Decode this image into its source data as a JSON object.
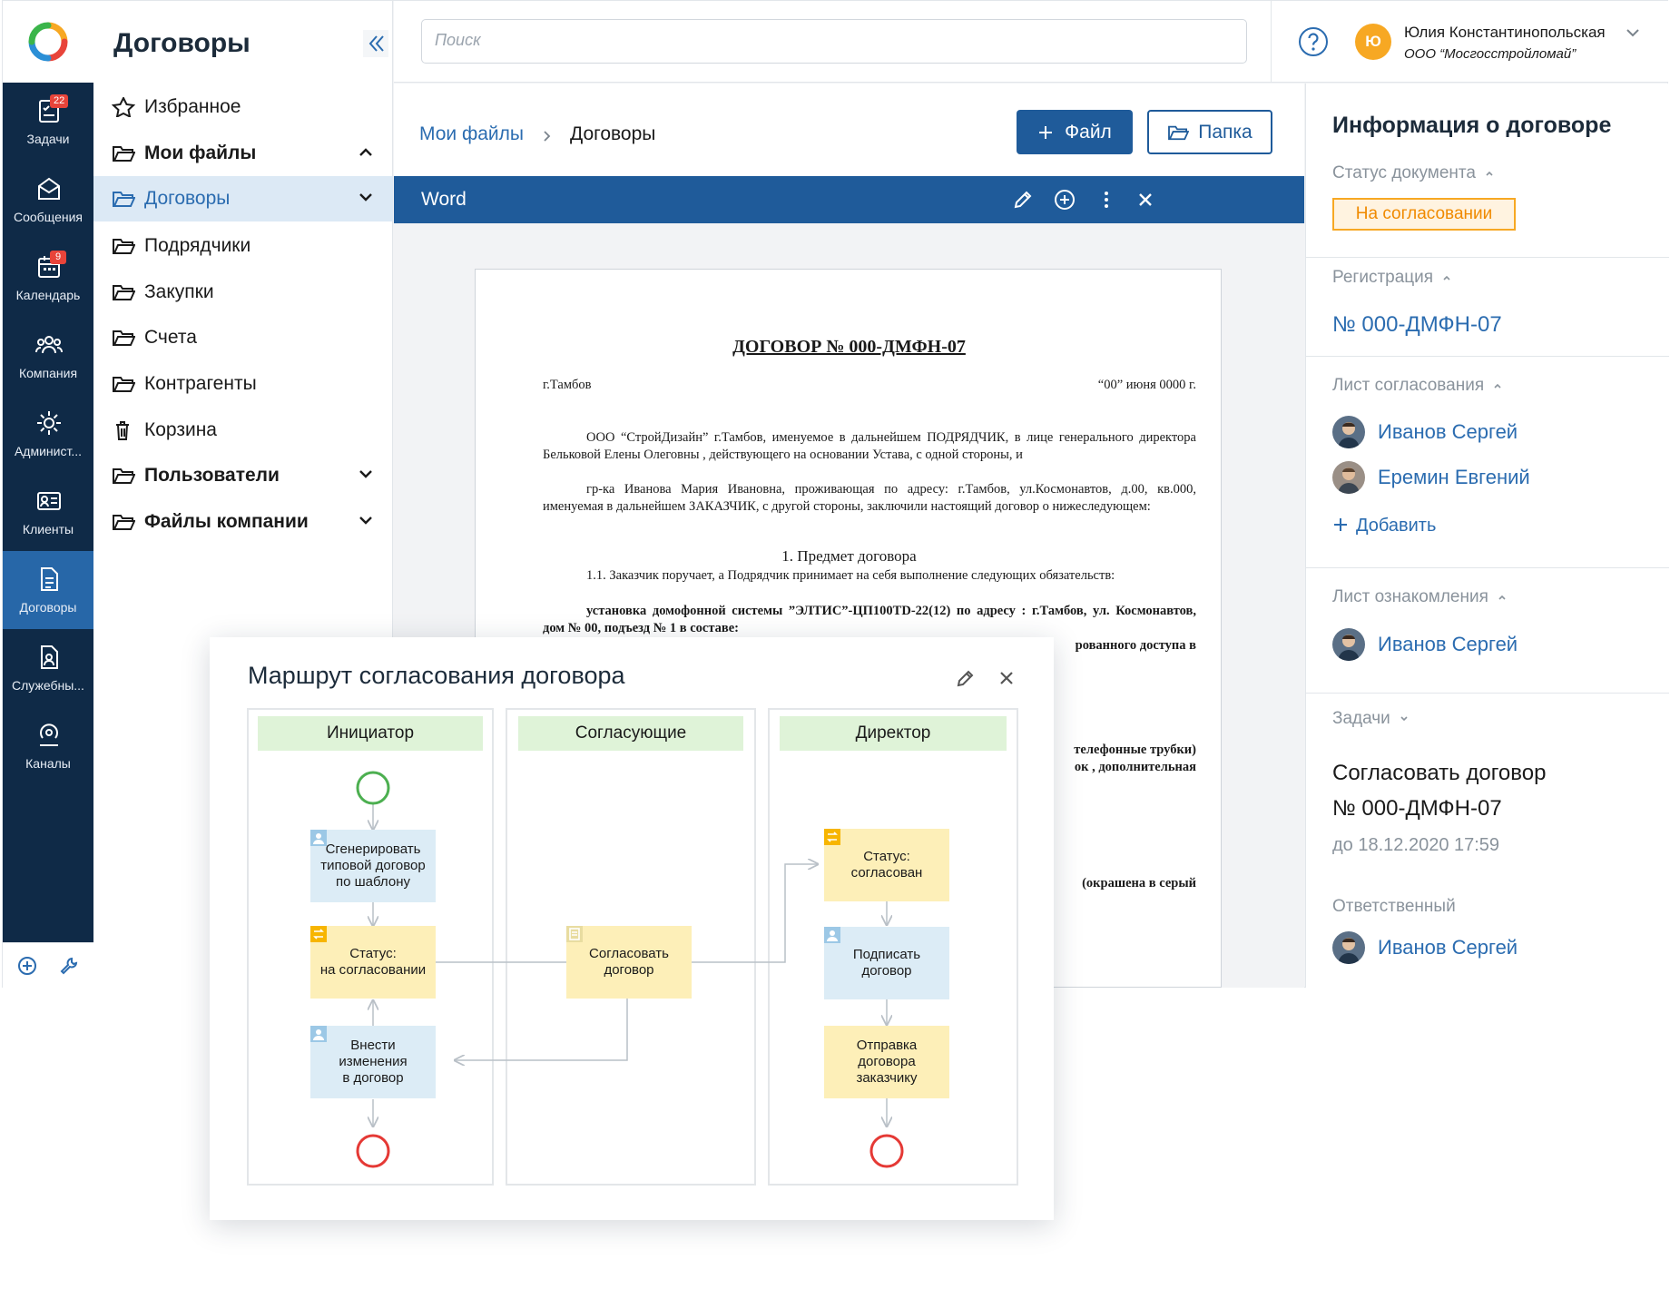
{
  "rail": {
    "items": [
      {
        "label": "Задачи",
        "count": "22"
      },
      {
        "label": "Сообщения"
      },
      {
        "label": "Календарь",
        "count": "9"
      },
      {
        "label": "Компания"
      },
      {
        "label": "Админист..."
      },
      {
        "label": "Клиенты"
      },
      {
        "label": "Договоры"
      },
      {
        "label": "Служебны..."
      },
      {
        "label": "Каналы"
      }
    ]
  },
  "tree": {
    "title": "Договоры",
    "items": [
      {
        "label": "Избранное"
      },
      {
        "label": "Мои файлы"
      },
      {
        "label": "Договоры"
      },
      {
        "label": "Подрядчики"
      },
      {
        "label": "Закупки"
      },
      {
        "label": "Счета"
      },
      {
        "label": "Контрагенты"
      },
      {
        "label": "Корзина"
      },
      {
        "label": "Пользователи"
      },
      {
        "label": "Файлы компании"
      }
    ]
  },
  "topbar": {
    "search_placeholder": "Поиск",
    "avatar_letter": "Ю",
    "user_name": "Юлия Константинопольская",
    "user_org": "ООО “Мосгосстройломай”"
  },
  "main": {
    "breadcrumb": {
      "parent": "Мои файлы",
      "current": "Договоры"
    },
    "file_button": "Файл",
    "folder_button": "Папка",
    "doc_title": "Word"
  },
  "document": {
    "heading": "ДОГОВОР № 000-ДМФН-07",
    "city": "г.Тамбов",
    "date": "“00” июня   0000 г.",
    "para1a": "ООО “СтройДизайн” г.Тамбов, именуемое в дальнейшем ПОДРЯДЧИК, в лице генерального директора Бельковой Елены Олеговны , действующего на основании Устава, с одной стороны, и",
    "para1b": "гр-ка Иванова Мария Ивановна, проживающая по адресу: г.Тамбов, ул.Космонавтов, д.00, кв.000, именуемая в дальнейшем ЗАКАЗЧИК, с другой стороны, заключили настоящий договор о нижеследующем:",
    "section1": "1. Предмет договора",
    "clause11": "1.1. Заказчик поручает, а Подрядчик принимает на себя выполнение следующих обязательств:",
    "clause11b": "установка домофонной системы ”ЭЛТИС”-ЦП100TD-22(12) по адресу : г.Тамбов, ул. Космонавтов, дом № 00, подъезд № 1 в составе:",
    "frag1": "рованного доступа в",
    "frag2": "телефонные трубки)",
    "frag3": "ок , дополнительная",
    "frag4": "(окрашена в серый"
  },
  "info": {
    "title": "Информация о договоре",
    "status_label": "Статус документа",
    "status_value": "На согласовании",
    "reg_label": "Регистрация",
    "reg_number": "№ 000-ДМФН-07",
    "approval_label": "Лист согласования",
    "approvers": [
      "Иванов Сергей",
      "Еремин Евгений"
    ],
    "add_label": "Добавить",
    "ack_label": "Лист ознакомления",
    "ack_people": [
      "Иванов Сергей"
    ],
    "tasks_label": "Задачи",
    "task_line1": "Согласовать договор",
    "task_line2": "№ 000-ДМФН-07",
    "task_due": "до 18.12.2020  17:59",
    "responsible_label": "Ответственный",
    "responsible": "Иванов Сергей"
  },
  "route": {
    "title": "Маршрут согласования договора",
    "lanes": [
      "Инициатор",
      "Согласующие",
      "Директор"
    ],
    "nodes": {
      "generate": [
        "Сгенерировать",
        "типовой договор",
        "по шаблону"
      ],
      "status_pending": [
        "Статус:",
        "на согласовании"
      ],
      "edit": [
        "Внести",
        "изменения",
        "в договор"
      ],
      "approve": [
        "Согласовать",
        "договор"
      ],
      "status_approved": [
        "Статус:",
        "согласован"
      ],
      "sign": [
        "Подписать",
        "договор"
      ],
      "send": [
        "Отправка",
        "договора",
        "заказчику"
      ]
    }
  },
  "colors": {
    "rail_bg": "#0f2a47",
    "accent": "#1f5b9a",
    "link": "#2b6cb0",
    "status": "#f7a823",
    "lane_header": "#dff3d8"
  }
}
